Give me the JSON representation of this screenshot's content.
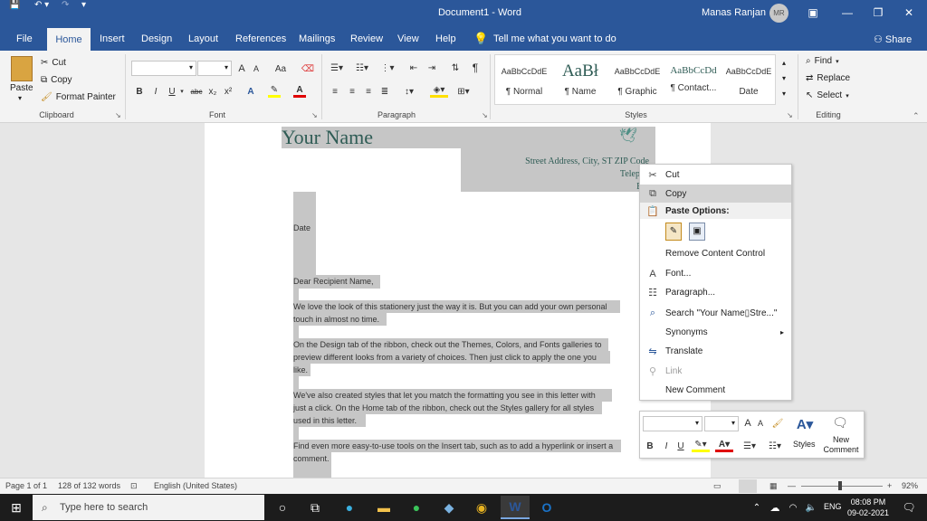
{
  "titlebar": {
    "doc_title": "Document1  -  Word",
    "user_name": "Manas Ranjan",
    "avatar_initials": "MR",
    "qat": [
      "💾",
      "↶",
      "↷",
      "⌄"
    ]
  },
  "tabs": [
    "File",
    "Home",
    "Insert",
    "Design",
    "Layout",
    "References",
    "Mailings",
    "Review",
    "View",
    "Help"
  ],
  "tell_me": "Tell me what you want to do",
  "share": "Share",
  "clipboard": {
    "paste": "Paste",
    "cut": "Cut",
    "copy": "Copy",
    "format_painter": "Format Painter",
    "label": "Clipboard"
  },
  "font": {
    "label": "Font",
    "size_up": "A",
    "size_down": "A",
    "case": "Aa",
    "bold": "B",
    "italic": "I",
    "underline": "U",
    "strike": "abc",
    "sub": "x₂",
    "sup": "x²"
  },
  "paragraph": {
    "label": "Paragraph",
    "pilcrow": "¶"
  },
  "styles": {
    "label": "Styles",
    "items": [
      {
        "preview": "AaBbCcDdE",
        "name": "¶ Normal"
      },
      {
        "preview": "AaBł",
        "name": "¶ Name"
      },
      {
        "preview": "AaBbCcDdE",
        "name": "¶ Graphic"
      },
      {
        "preview": "AaBbCcDd",
        "name": "¶ Contact..."
      },
      {
        "preview": "AaBbCcDdE",
        "name": "Date"
      }
    ]
  },
  "editing": {
    "find": "Find",
    "replace": "Replace",
    "select": "Select",
    "label": "Editing"
  },
  "document": {
    "your_name": "Your Name",
    "address": "Street Address, City, ST ZIP Code",
    "telephone": "Telepho",
    "email": "Em",
    "date": "Date",
    "salutation": "Dear Recipient Name,",
    "p1a": "We love the look of this stationery just the way it is. But you can add your own personal",
    "p1b": "touch in almost no time.",
    "p2a": "On the Design tab of the ribbon, check out the Themes, Colors, and Fonts galleries to",
    "p2b": "preview different looks from a variety of choices. Then just click to apply the one you",
    "p2c": "like.",
    "p3a": "We've also created styles that let you match the formatting you see in this letter with",
    "p3b": "just a click. On the Home tab of the ribbon, check out the Styles gallery for all styles",
    "p3c": "used in this letter.",
    "p4a": "Find even more easy-to-use tools on the Insert tab, such as to add a hyperlink or insert a",
    "p4b": "comment."
  },
  "context_menu": {
    "cut": "Cut",
    "copy": "Copy",
    "paste_options": "Paste Options:",
    "remove_content_control": "Remove Content Control",
    "font": "Font...",
    "paragraph": "Paragraph...",
    "search": "Search \"Your Name▯Stre...\"",
    "synonyms": "Synonyms",
    "translate": "Translate",
    "link": "Link",
    "new_comment": "New Comment"
  },
  "mini_toolbar": {
    "styles": "Styles",
    "new_comment_1": "New",
    "new_comment_2": "Comment"
  },
  "statusbar": {
    "page": "Page 1 of 1",
    "words": "128 of 132 words",
    "language": "English (United States)",
    "zoom": "92%"
  },
  "taskbar": {
    "search_placeholder": "Type here to search",
    "lang": "ENG",
    "time": "08:08 PM",
    "date": "09-02-2021"
  },
  "colors": {
    "accent": "#2b579a",
    "highlight": "#c6c6c6",
    "name_text": "#2f5c55"
  }
}
